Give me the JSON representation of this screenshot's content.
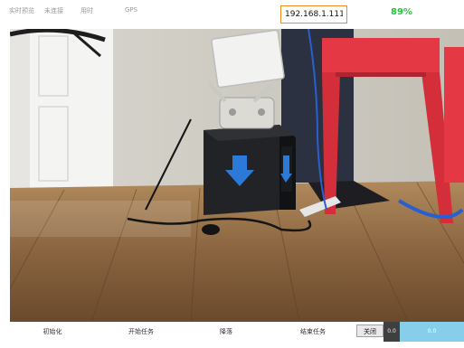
{
  "status": {
    "live_preview": "实时预览",
    "connection": "未连接",
    "duration": "用时",
    "gps": "GPS",
    "battery": "89%"
  },
  "ip_field": {
    "value": "192.168.1.111"
  },
  "toolbar": {
    "init": "初始化",
    "start_task": "开始任务",
    "land": "降落",
    "end_task": "结束任务",
    "close": "关闭",
    "value_left": "0.0",
    "value_right": "0.0"
  },
  "colors": {
    "ip_border": "#f08a24",
    "battery": "#22c43a",
    "value_bg": "#87ceeb"
  },
  "icons": {
    "box_arrow": "down-arrow-icon"
  }
}
